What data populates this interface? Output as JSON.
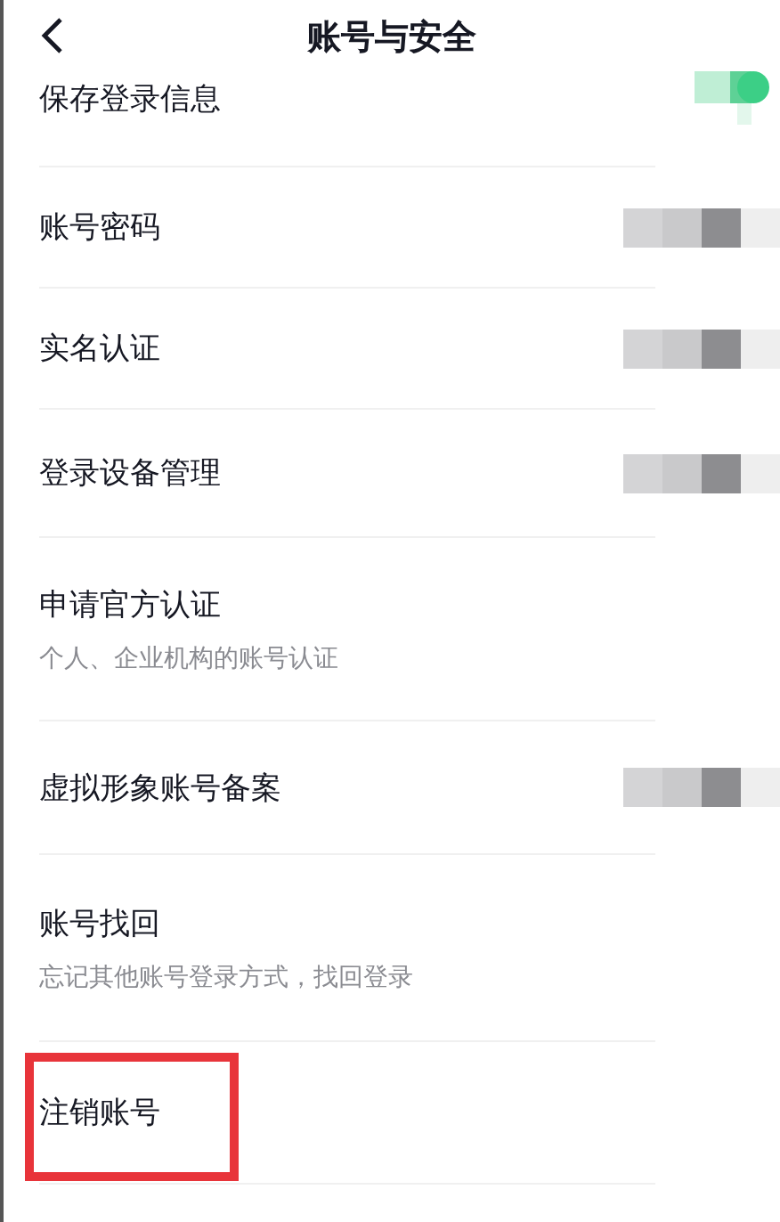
{
  "header": {
    "title": "账号与安全"
  },
  "items": [
    {
      "label": "保存登录信息",
      "kind": "toggle",
      "on": true,
      "highlighted": false
    },
    {
      "label": "账号密码",
      "kind": "obscured",
      "highlighted": false
    },
    {
      "label": "实名认证",
      "kind": "obscured",
      "highlighted": false
    },
    {
      "label": "登录设备管理",
      "kind": "obscured",
      "highlighted": false
    },
    {
      "label": "申请官方认证",
      "subtitle": "个人、企业机构的账号认证",
      "kind": "plain",
      "highlighted": false
    },
    {
      "label": "虚拟形象账号备案",
      "kind": "obscured",
      "highlighted": false
    },
    {
      "label": "账号找回",
      "subtitle": "忘记其他账号登录方式，找回登录",
      "kind": "plain",
      "highlighted": false
    },
    {
      "label": "注销账号",
      "kind": "plain",
      "highlighted": true
    }
  ]
}
